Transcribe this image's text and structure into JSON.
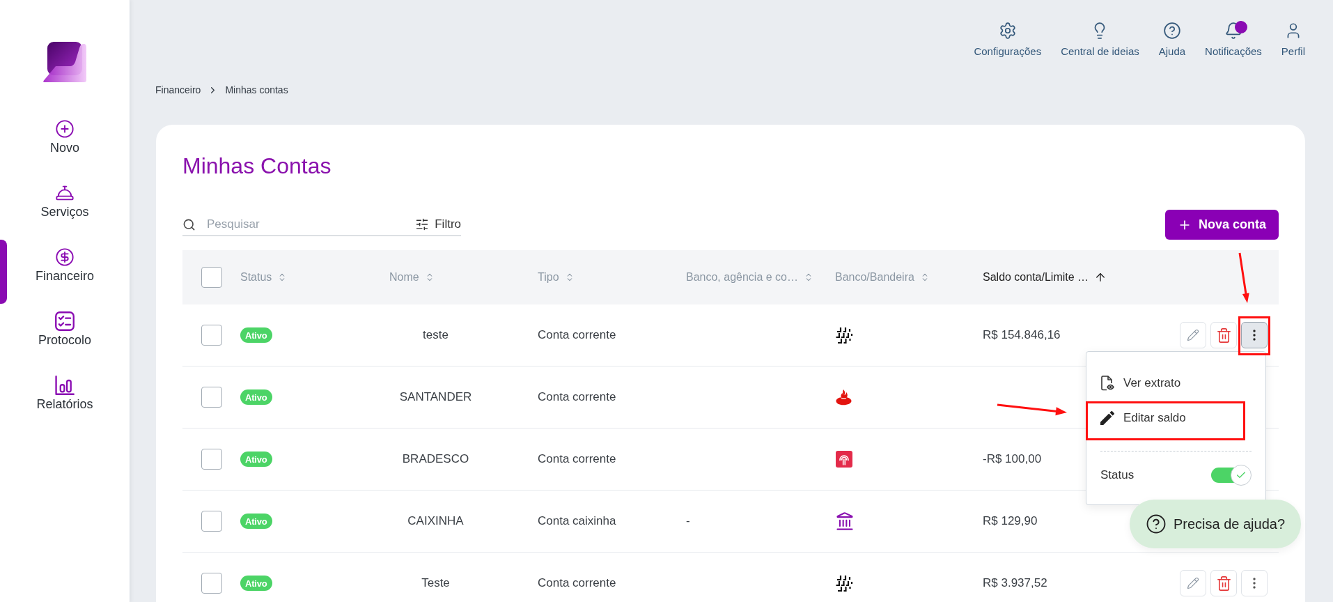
{
  "sidebar": {
    "items": [
      {
        "label": "Novo",
        "kind": "new",
        "selected": false
      },
      {
        "label": "Serviços",
        "kind": "services",
        "selected": false
      },
      {
        "label": "Financeiro",
        "kind": "finance",
        "selected": true
      },
      {
        "label": "Protocolo",
        "kind": "protocol",
        "selected": false
      },
      {
        "label": "Relatórios",
        "kind": "reports",
        "selected": false
      }
    ]
  },
  "header": {
    "actions": [
      {
        "label": "Configurações",
        "kind": "settings",
        "unread": false
      },
      {
        "label": "Central de ideias",
        "kind": "ideas",
        "unread": false
      },
      {
        "label": "Ajuda",
        "kind": "help",
        "unread": false
      },
      {
        "label": "Notificações",
        "kind": "notifications",
        "unread": true
      },
      {
        "label": "Perfil",
        "kind": "profile",
        "unread": false
      }
    ]
  },
  "breadcrumb": [
    {
      "label": "Financeiro"
    },
    {
      "label": "Minhas contas"
    }
  ],
  "page_title": "Minhas Contas",
  "toolbar": {
    "search": {
      "placeholder": "Pesquisar"
    },
    "filter_label": "Filtro",
    "new_button": "Nova conta"
  },
  "table": {
    "select_all": {
      "checked": false
    },
    "columns": [
      {
        "label": "Status",
        "sorted": false
      },
      {
        "label": "Nome",
        "sorted": false
      },
      {
        "label": "Tipo",
        "sorted": false
      },
      {
        "label": "Banco, agência e co…",
        "sorted": false
      },
      {
        "label": "Banco/Bandeira",
        "sorted": false
      },
      {
        "label": "Saldo conta/Limite …",
        "sorted": true
      }
    ],
    "rows": [
      {
        "checked": false,
        "status": "Ativo",
        "name": "teste",
        "type": "Conta corrente",
        "logo": {
          "kind": "grid"
        },
        "balance": "R$ 154.846,16",
        "show_actions": true,
        "menu_open": true
      },
      {
        "checked": false,
        "status": "Ativo",
        "name": "SANTANDER",
        "type": "Conta corrente",
        "logo": {
          "kind": "flame"
        },
        "show_actions": false,
        "menu_open": false
      },
      {
        "checked": false,
        "status": "Ativo",
        "name": "BRADESCO",
        "type": "Conta corrente",
        "logo": {
          "kind": "tree"
        },
        "balance": "-R$ 100,00",
        "show_actions": false,
        "menu_open": false
      },
      {
        "checked": false,
        "status": "Ativo",
        "name": "CAIXINHA",
        "type": "Conta caixinha",
        "bank_branch": "-",
        "logo": {
          "kind": "bank"
        },
        "balance": "R$ 129,90",
        "show_actions": false,
        "menu_open": false
      },
      {
        "checked": false,
        "status": "Ativo",
        "name": "Teste",
        "type": "Conta corrente",
        "logo": {
          "kind": "grid"
        },
        "balance": "R$ 3.937,52",
        "show_actions": true,
        "menu_open": false
      }
    ]
  },
  "row_menu": {
    "items": [
      {
        "label": "Ver extrato",
        "kind": "statement"
      },
      {
        "label": "Editar saldo",
        "kind": "edit"
      }
    ],
    "status": {
      "label": "Status",
      "on": true
    }
  },
  "help_button": "Precisa de ajuda?"
}
